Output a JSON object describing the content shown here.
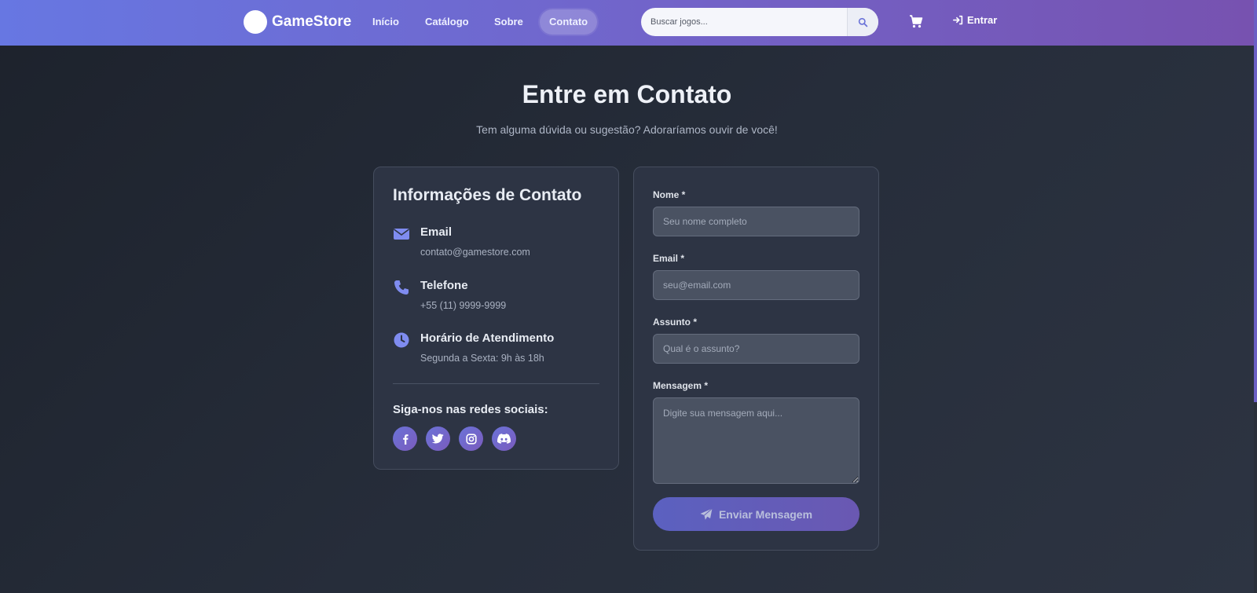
{
  "nav": {
    "brand": "GameStore",
    "links": [
      "Início",
      "Catálogo",
      "Sobre",
      "Contato"
    ],
    "active_link": "Contato",
    "search_placeholder": "Buscar jogos...",
    "login_label": "Entrar"
  },
  "header": {
    "title": "Entre em Contato",
    "subtitle": "Tem alguma dúvida ou sugestão? Adoraríamos ouvir de você!"
  },
  "info": {
    "title": "Informações de Contato",
    "items": [
      {
        "icon": "envelope-icon",
        "label": "Email",
        "value": "contato@gamestore.com"
      },
      {
        "icon": "phone-icon",
        "label": "Telefone",
        "value": "+55 (11) 9999-9999"
      },
      {
        "icon": "clock-icon",
        "label": "Horário de Atendimento",
        "value": "Segunda a Sexta: 9h às 18h"
      }
    ],
    "social_title": "Siga-nos nas redes sociais:",
    "social": [
      "facebook-icon",
      "twitter-icon",
      "instagram-icon",
      "discord-icon"
    ]
  },
  "form": {
    "fields": [
      {
        "label": "Nome *",
        "placeholder": "Seu nome completo"
      },
      {
        "label": "Email *",
        "placeholder": "seu@email.com"
      },
      {
        "label": "Assunto *",
        "placeholder": "Qual é o assunto?"
      },
      {
        "label": "Mensagem *",
        "placeholder": "Digite sua mensagem aqui..."
      }
    ],
    "submit_label": "Enviar Mensagem"
  },
  "colors": {
    "nav_start": "#6777e2",
    "nav_end": "#7752b0",
    "accent_icon": "#7f8cf0",
    "card_bg": "#2d3444"
  }
}
